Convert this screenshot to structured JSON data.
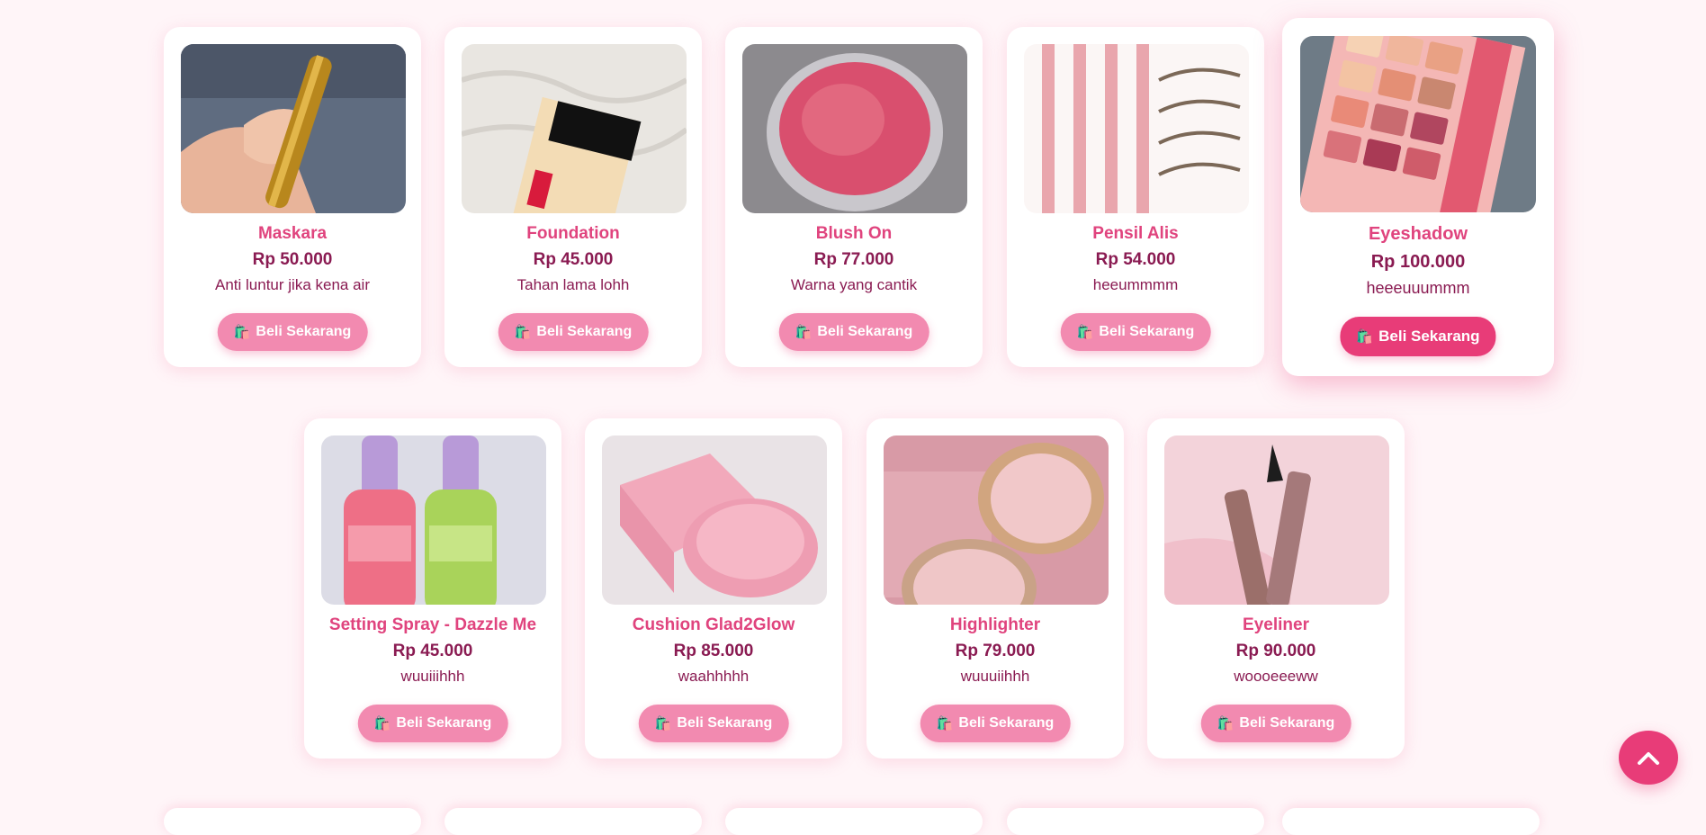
{
  "products": [
    {
      "name": "Maskara",
      "price": "Rp 50.000",
      "desc": "Anti luntur jika kena air",
      "button": "Beli Sekarang"
    },
    {
      "name": "Foundation",
      "price": "Rp 45.000",
      "desc": "Tahan lama lohh",
      "button": "Beli Sekarang"
    },
    {
      "name": "Blush On",
      "price": "Rp 77.000",
      "desc": "Warna yang cantik",
      "button": "Beli Sekarang"
    },
    {
      "name": "Pensil Alis",
      "price": "Rp 54.000",
      "desc": "heeummmm",
      "button": "Beli Sekarang"
    },
    {
      "name": "Eyeshadow",
      "price": "Rp 100.000",
      "desc": "heeeuuummm",
      "button": "Beli Sekarang"
    },
    {
      "name": "Setting Spray - Dazzle Me",
      "price": "Rp 45.000",
      "desc": "wuuiiihhh",
      "button": "Beli Sekarang"
    },
    {
      "name": "Cushion Glad2Glow",
      "price": "Rp 85.000",
      "desc": "waahhhhh",
      "button": "Beli Sekarang"
    },
    {
      "name": "Highlighter",
      "price": "Rp 79.000",
      "desc": "wuuuiihhh",
      "button": "Beli Sekarang"
    },
    {
      "name": "Eyeliner",
      "price": "Rp 90.000",
      "desc": "woooeeeww",
      "button": "Beli Sekarang"
    }
  ],
  "icons": {
    "buy": "shopping-bags-icon",
    "scroll_top": "chevron-up-icon"
  },
  "colors": {
    "accent": "#e83c78",
    "button": "#f28ab0",
    "title": "#e0447e",
    "text": "#8a1b52",
    "background": "#fff5f8"
  }
}
